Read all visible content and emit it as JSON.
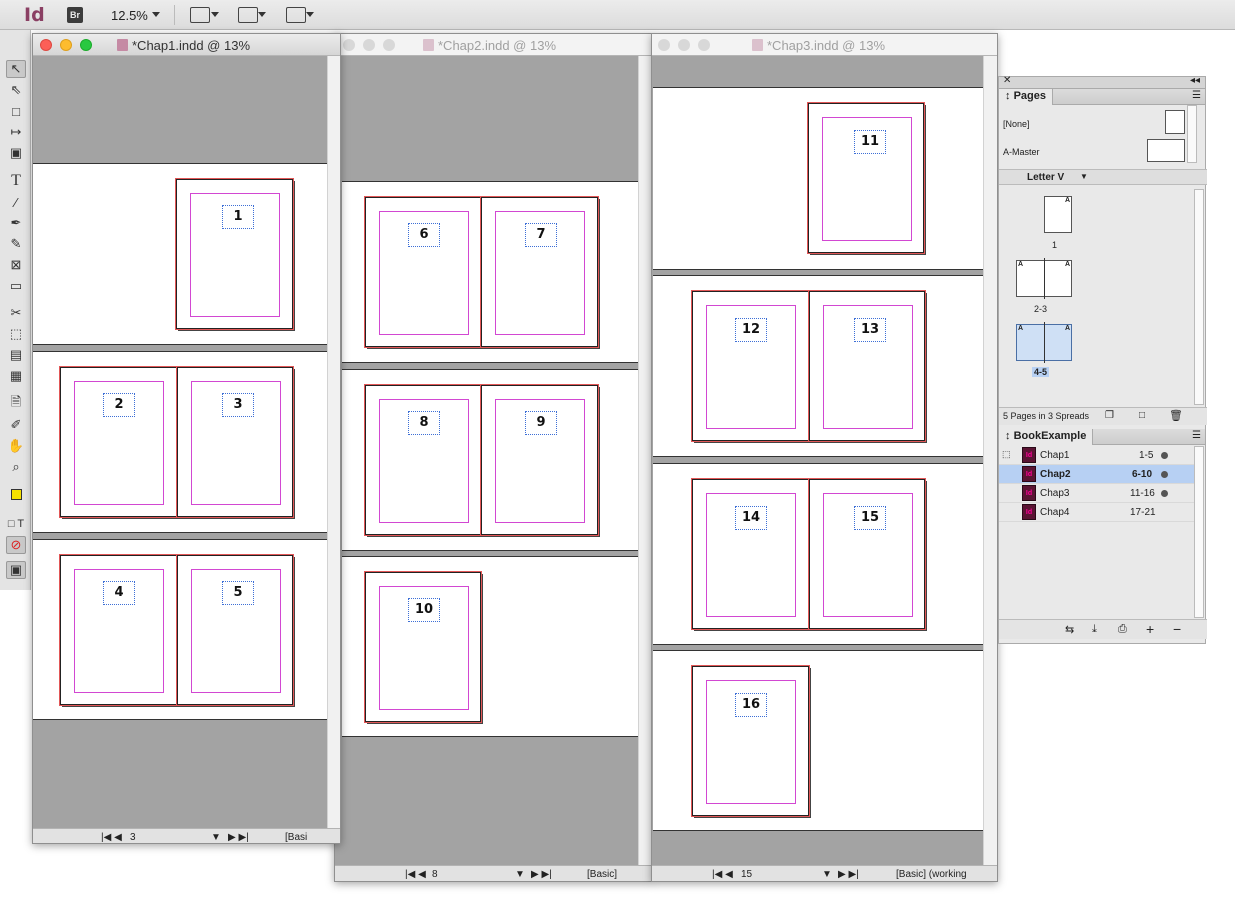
{
  "app": {
    "logo": "Id",
    "bridge": "Br",
    "zoom": "12.5%"
  },
  "windows": [
    {
      "title": "*Chap1.indd @ 13%",
      "page_field": "3",
      "status_text": "[Basi",
      "active": true
    },
    {
      "title": "*Chap2.indd @ 13%",
      "page_field": "8",
      "status_text": "[Basic]",
      "active": false
    },
    {
      "title": "*Chap3.indd @ 13%",
      "page_field": "15",
      "status_text": "[Basic] (working",
      "active": false
    }
  ],
  "page_numbers": {
    "chap1": [
      "1",
      "2",
      "3",
      "4",
      "5"
    ],
    "chap2": [
      "6",
      "7",
      "8",
      "9",
      "10"
    ],
    "chap3": [
      "11",
      "12",
      "13",
      "14",
      "15",
      "16"
    ]
  },
  "pages_panel": {
    "tab": "Pages",
    "none_label": "[None]",
    "master_label": "A-Master",
    "page_size": "Letter V",
    "thumb_labels": [
      "1",
      "2-3",
      "4-5"
    ],
    "master_letter": "A",
    "footer": "5 Pages in 3 Spreads"
  },
  "book_panel": {
    "tab": "BookExample",
    "chapters": [
      {
        "name": "Chap1",
        "range": "1-5",
        "selected": false
      },
      {
        "name": "Chap2",
        "range": "6-10",
        "selected": true
      },
      {
        "name": "Chap3",
        "range": "11-16",
        "selected": false
      },
      {
        "name": "Chap4",
        "range": "17-21",
        "selected": false
      }
    ],
    "doc_icon_text": "Id"
  }
}
